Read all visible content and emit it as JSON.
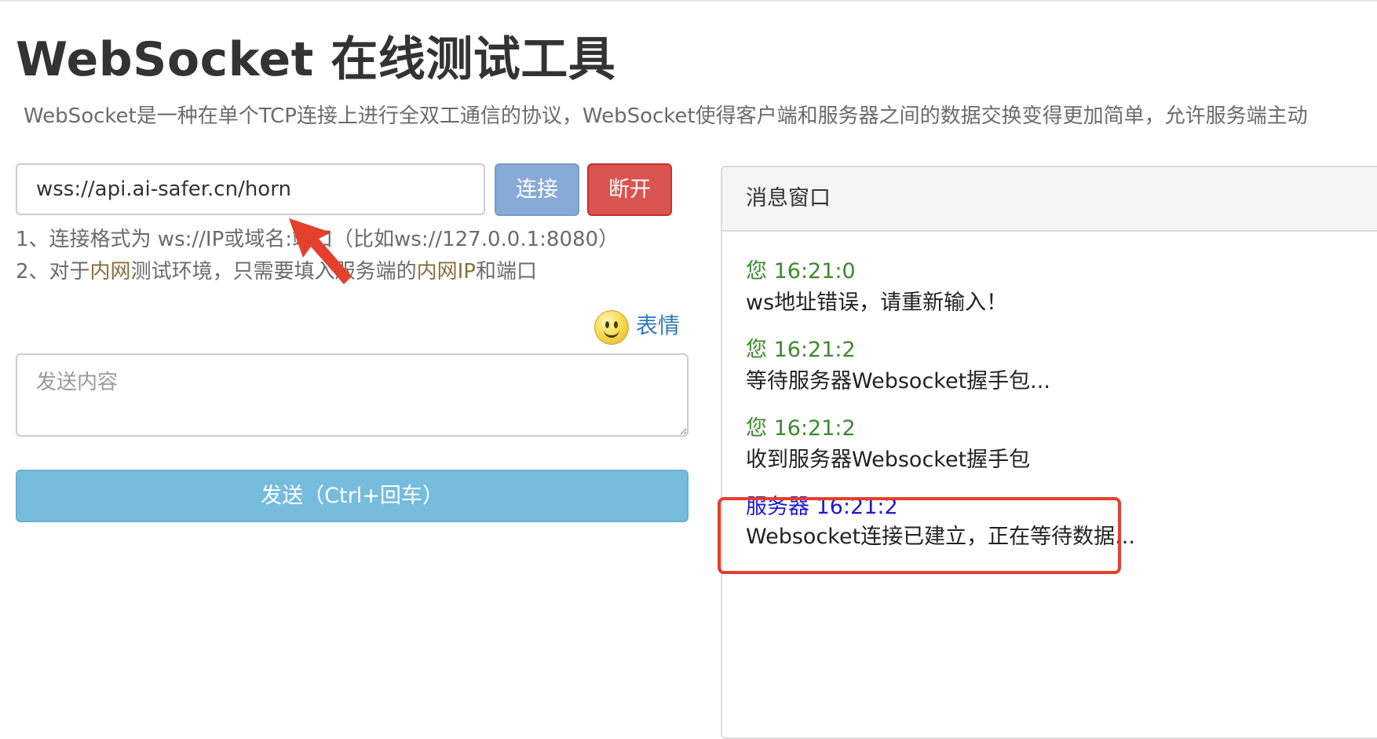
{
  "header": {
    "title": "WebSocket 在线测试工具",
    "description": "WebSocket是一种在单个TCP连接上进行全双工通信的协议，WebSocket使得客户端和服务器之间的数据交换变得更加简单，允许服务端主动"
  },
  "connection": {
    "url_value": "wss://api.ai-safer.cn/horn",
    "connect_label": "连接",
    "disconnect_label": "断开"
  },
  "hints": {
    "line1": "1、连接格式为 ws://IP或域名:端口（比如ws://127.0.0.1:8080）",
    "line2_prefix": "2、对于",
    "line2_hl1": "内网",
    "line2_mid": "测试环境，只需要填入服务端的",
    "line2_hl2": "内网IP",
    "line2_suffix": "和端口"
  },
  "compose": {
    "emoji_icon": "smiley-face-icon",
    "emoji_label": "表情",
    "placeholder": "发送内容",
    "send_label": "发送（Ctrl+回车）"
  },
  "messages_panel": {
    "title": "消息窗口",
    "messages": [
      {
        "sender": "您",
        "time": "16:21:0",
        "meta": "您 16:21:0",
        "text": "ws地址错误，请重新输入！",
        "role": "you"
      },
      {
        "sender": "您",
        "time": "16:21:2",
        "meta": "您 16:21:2",
        "text": "等待服务器Websocket握手包...",
        "role": "you"
      },
      {
        "sender": "您",
        "time": "16:21:2",
        "meta": "您 16:21:2",
        "text": "收到服务器Websocket握手包",
        "role": "you"
      },
      {
        "sender": "服务器",
        "time": "16:21:2",
        "meta": "服务器 16:21:2",
        "text": "Websocket连接已建立，正在等待数据...",
        "role": "server"
      }
    ]
  },
  "colors": {
    "connect_button": "#88aad6",
    "disconnect_button": "#d9534f",
    "send_button": "#76bcdc",
    "you_meta": "#3c8a2e",
    "server_meta": "#1a1ad6",
    "highlight_hint": "#8a6d3b",
    "annotation_red": "#e3402d"
  }
}
